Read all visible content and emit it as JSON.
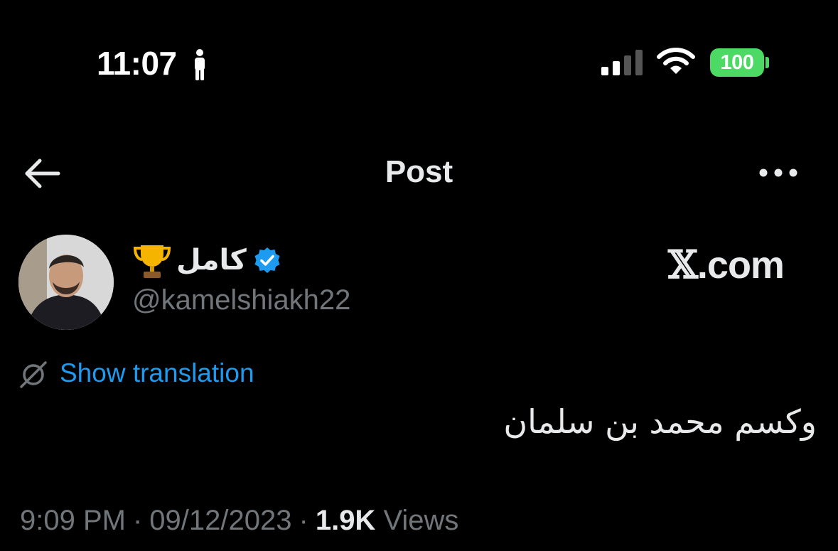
{
  "status_bar": {
    "time": "11:07",
    "battery": "100",
    "colors": {
      "battery": "#4cd964"
    }
  },
  "nav": {
    "title": "Post",
    "back_icon": "arrow-left-icon",
    "more_icon": "more-horizontal-icon"
  },
  "author": {
    "name": "كامل",
    "handle": "@kamelshiakh22",
    "verified": true,
    "name_emoji": "trophy-icon",
    "verified_color": "#1d9bf0"
  },
  "watermark": {
    "x_glyph": "𝕏",
    "text": ".com"
  },
  "translation": {
    "label": "Show translation",
    "color": "#1d9bf0"
  },
  "tweet": {
    "text": "وكسم محمد بن سلمان"
  },
  "meta": {
    "time": "9:09 PM",
    "date": "09/12/2023",
    "views_count": "1.9K",
    "views_label": "Views",
    "separator": "·"
  }
}
